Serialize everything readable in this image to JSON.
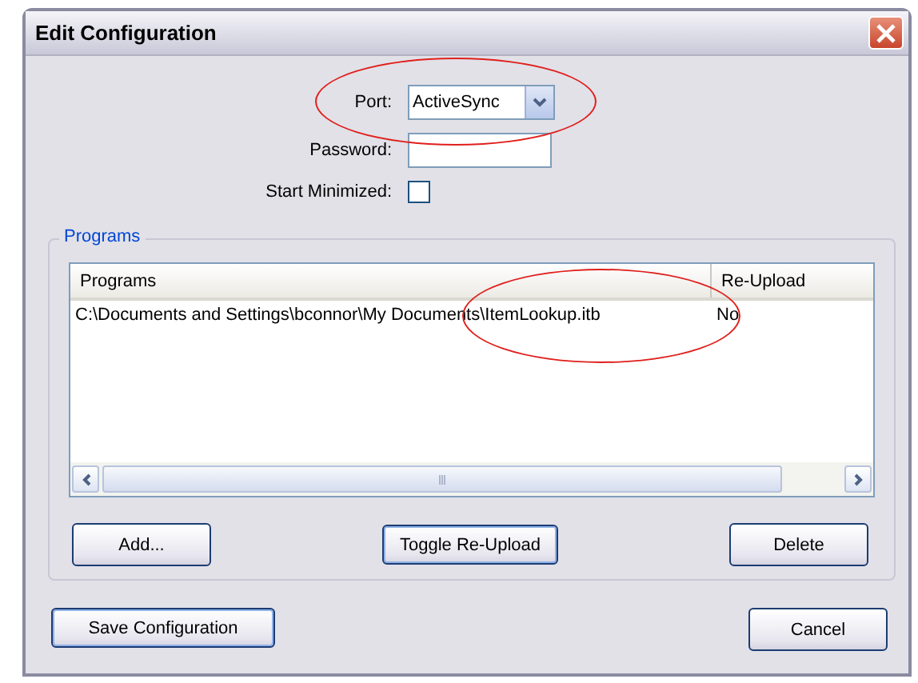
{
  "window": {
    "title": "Edit Configuration"
  },
  "port": {
    "label": "Port:",
    "value": "ActiveSync",
    "highlighted": true
  },
  "password": {
    "label": "Password:"
  },
  "start_minimized": {
    "label": "Start Minimized:",
    "checked": false
  },
  "programs": {
    "title": "Programs",
    "columns": [
      "Programs",
      "Re-Upload"
    ],
    "rows": [
      {
        "path": "C:\\Documents and Settings\\bconnor\\My Documents\\ItemLookup.itb",
        "reupload": "No",
        "highlighted": true
      }
    ],
    "buttons": [
      {
        "label": "Add...",
        "focused": false
      },
      {
        "label": "Toggle Re-Upload",
        "focused": true
      },
      {
        "label": "Delete",
        "focused": false
      }
    ]
  },
  "buttons": [
    {
      "label": "Save Configuration",
      "focused": true
    },
    {
      "label": "Cancel",
      "focused": false
    }
  ]
}
